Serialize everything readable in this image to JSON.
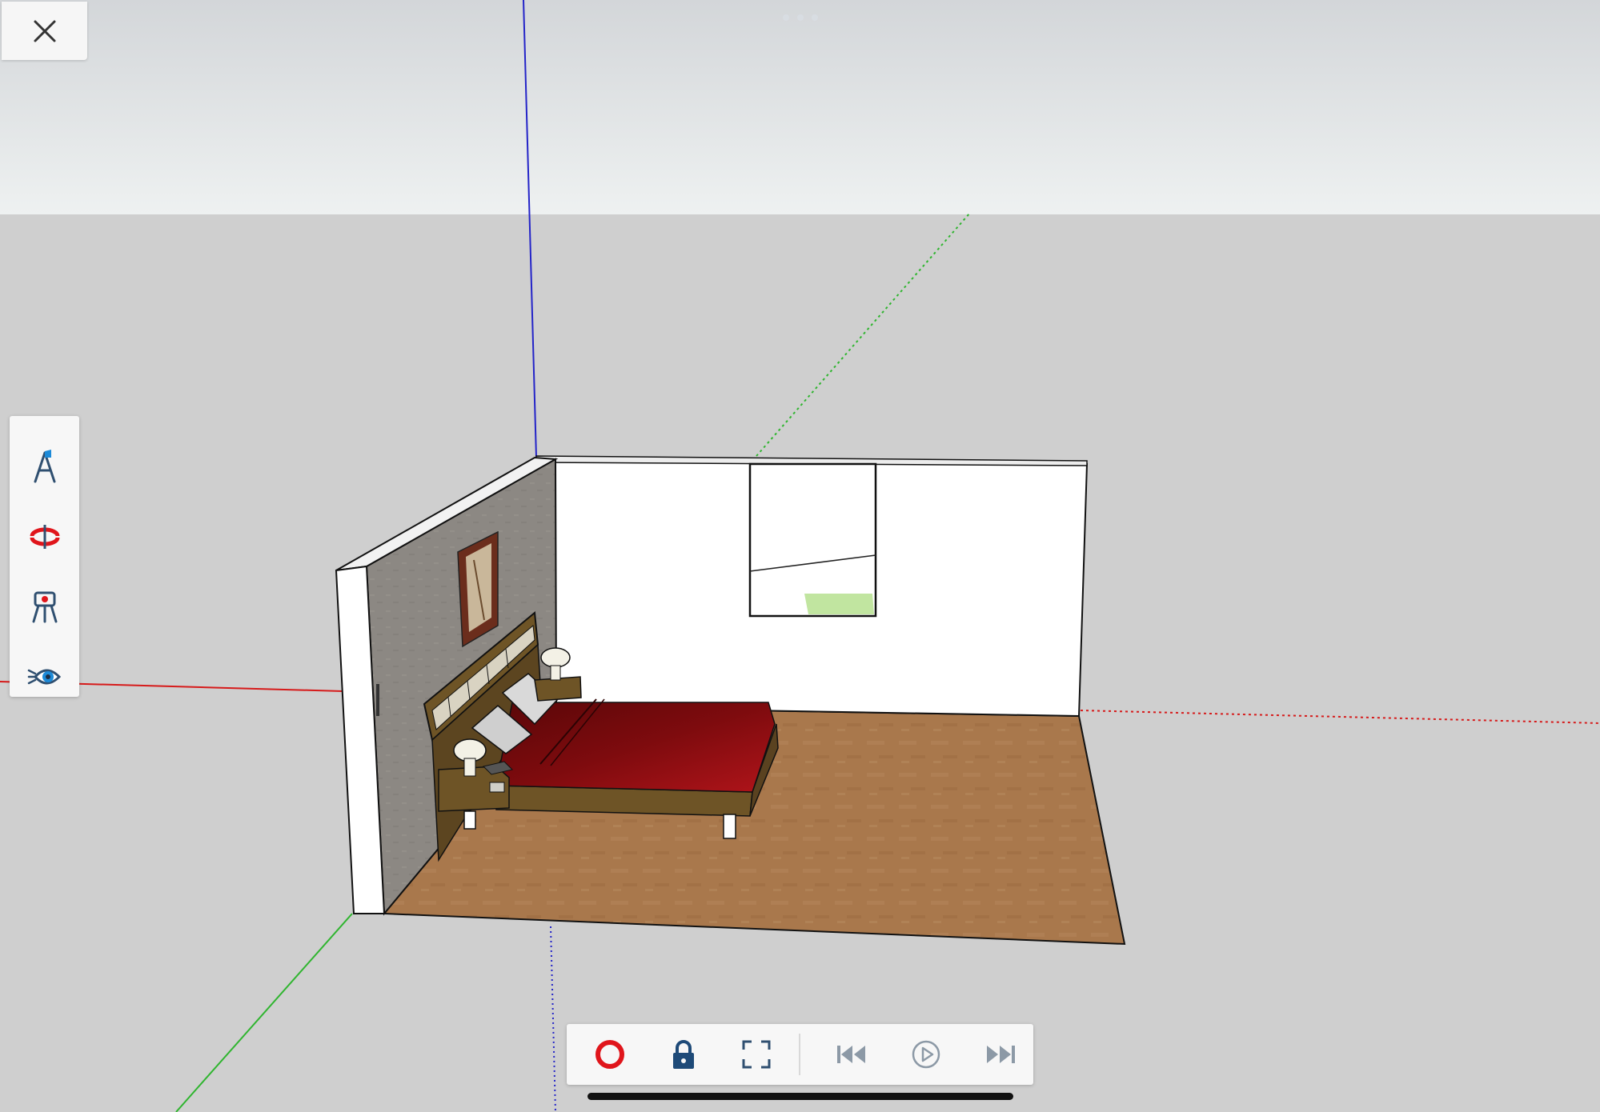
{
  "colors": {
    "sky_top": "#d3d6d9",
    "sky_bottom": "#eef1f1",
    "ground": "#cfcfcf",
    "axis_red": "#d61a1a",
    "axis_green": "#2fb52f",
    "axis_blue": "#2424c8",
    "floor": "#a9784c",
    "wall_grey": "#8e8a84",
    "bed_red": "#9b0f12",
    "wood": "#6e5426",
    "record_red": "#e0151b",
    "icon_blue": "#2f4f70",
    "icon_grey": "#8c99a6"
  },
  "top_bar": {
    "close_icon": "close-icon",
    "handle_icon": "more-dots-icon"
  },
  "side_toolbar": {
    "tools": [
      {
        "name": "walk-tool",
        "icon": "walk-icon"
      },
      {
        "name": "orbit-tool",
        "icon": "orbit-icon"
      },
      {
        "name": "position-camera-tool",
        "icon": "position-camera-icon"
      },
      {
        "name": "look-around-tool",
        "icon": "look-around-icon"
      }
    ]
  },
  "bottom_toolbar": {
    "tools": [
      {
        "name": "record-button",
        "icon": "record-icon"
      },
      {
        "name": "lock-button",
        "icon": "lock-icon"
      },
      {
        "name": "fullscreen-button",
        "icon": "fullscreen-icon"
      },
      {
        "name": "previous-scene-button",
        "icon": "skip-back-icon"
      },
      {
        "name": "play-button",
        "icon": "play-icon"
      },
      {
        "name": "next-scene-button",
        "icon": "skip-forward-icon"
      }
    ]
  }
}
